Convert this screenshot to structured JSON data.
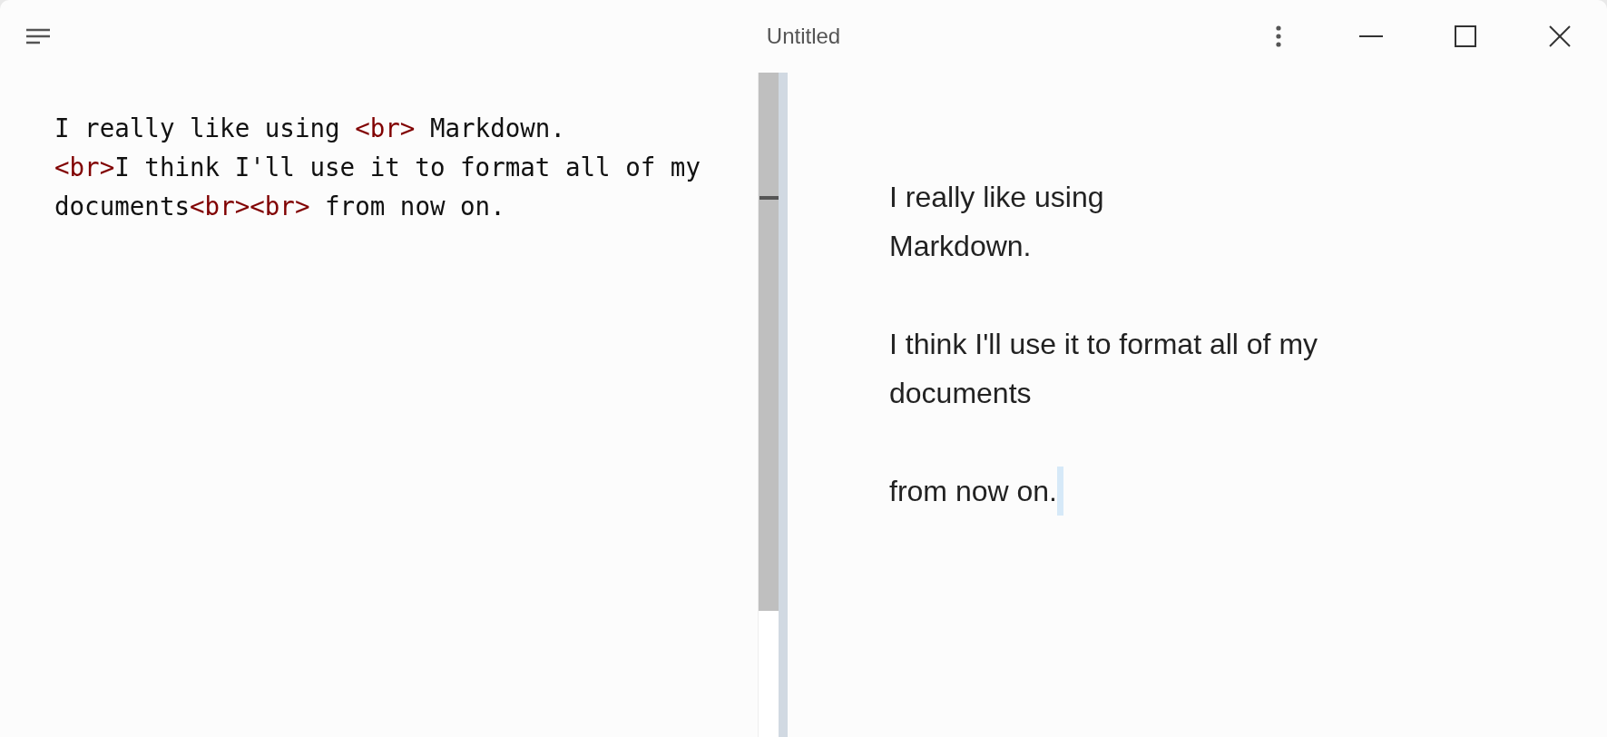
{
  "window": {
    "title": "Untitled"
  },
  "editor": {
    "lines": [
      [
        {
          "kind": "text",
          "text": "I really like using "
        },
        {
          "kind": "tag",
          "text": "<br>"
        },
        {
          "kind": "text",
          "text": " Markdown."
        }
      ],
      [
        {
          "kind": "tag",
          "text": "<br>"
        },
        {
          "kind": "text",
          "text": "I think I'll use it to format all of my"
        }
      ],
      [
        {
          "kind": "text",
          "text": "documents"
        },
        {
          "kind": "tag",
          "text": "<br>"
        },
        {
          "kind": "tag",
          "text": "<br>"
        },
        {
          "kind": "text",
          "text": " from now on."
        }
      ]
    ]
  },
  "preview": {
    "paragraphs": [
      [
        "I really like using",
        "Markdown."
      ],
      [
        "I think I'll use it to format all of my",
        "documents"
      ],
      [
        "from now on."
      ]
    ]
  }
}
